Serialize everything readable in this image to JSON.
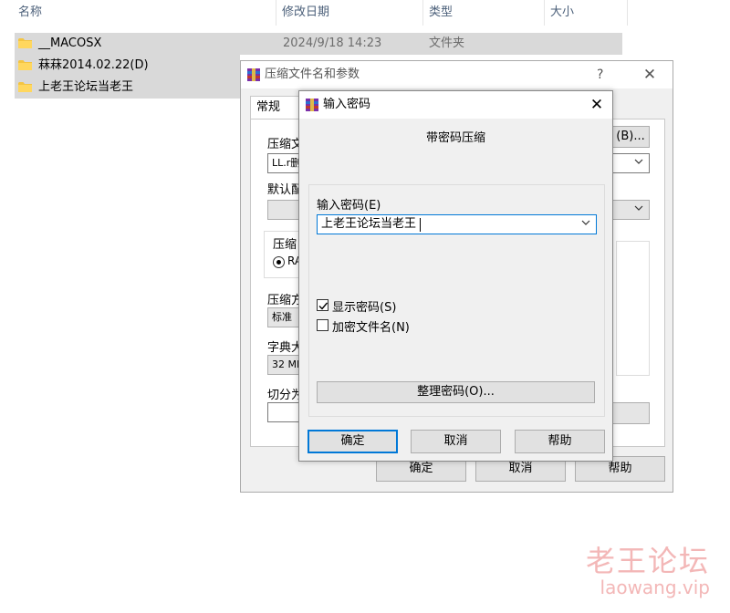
{
  "explorer": {
    "columns": {
      "name": "名称",
      "date": "修改日期",
      "type": "类型",
      "size": "大小"
    },
    "rows": [
      {
        "name": "__MACOSX",
        "date": "2024/9/18 14:23",
        "type": "文件夹"
      },
      {
        "name": "菻菻2014.02.22(D)"
      },
      {
        "name": "上老王论坛当老王"
      }
    ]
  },
  "archive_dialog": {
    "title": "压缩文件名和参数",
    "help": "?",
    "tab_general": "常规",
    "archive_name_label": "压缩文",
    "archive_name_value": "LL.r删",
    "browse_button": "(B)...",
    "default_profile_label": "默认配",
    "archive_format_label": "压缩",
    "format_option": "RA",
    "method_label": "压缩方",
    "method_value": "标准",
    "dict_label": "字典大",
    "dict_value": "32 MB",
    "split_label": "切分为",
    "ok": "确定",
    "cancel": "取消",
    "help_button": "帮助"
  },
  "password_dialog": {
    "title": "输入密码",
    "subtitle": "带密码压缩",
    "enter_label": "输入密码(E)",
    "password_value": "上老王论坛当老王",
    "show_password": "显示密码(S)",
    "show_password_checked": true,
    "encrypt_names": "加密文件名(N)",
    "encrypt_names_checked": false,
    "organize_button": "整理密码(O)...",
    "ok": "确定",
    "cancel": "取消",
    "help": "帮助"
  },
  "watermark": {
    "cn": "老王论坛",
    "en": "laowang.vip"
  },
  "colors": {
    "selection": "#d9d9d9",
    "accent": "#0078d7",
    "folder": "#f4c542",
    "watermark": "#f3b7b7"
  }
}
